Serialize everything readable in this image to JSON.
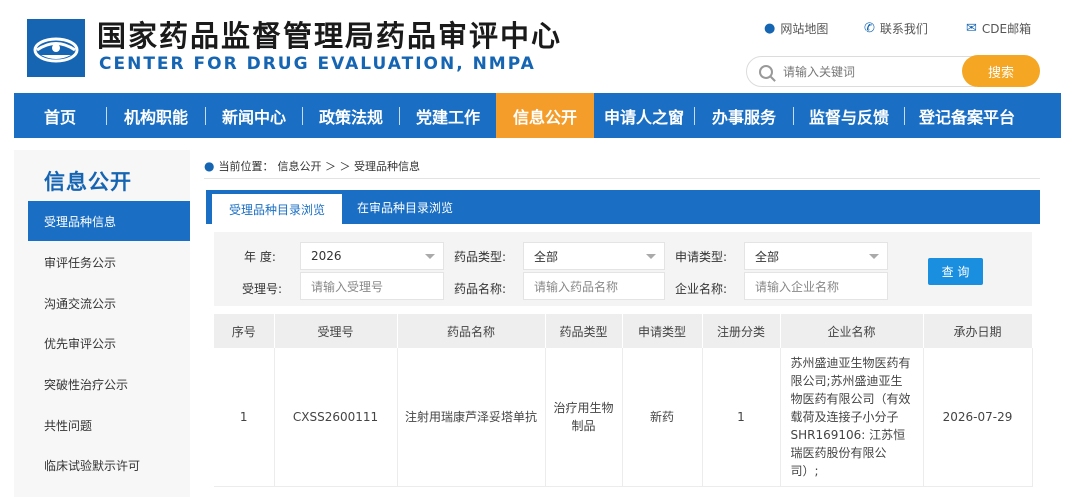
{
  "header": {
    "title_cn": "国家药品监督管理局药品审评中心",
    "title_en": "CENTER FOR DRUG EVALUATION, NMPA",
    "links": [
      {
        "label": "网站地图",
        "icon": "map-pin-icon"
      },
      {
        "label": "联系我们",
        "icon": "phone-icon"
      },
      {
        "label": "CDE邮箱",
        "icon": "mail-icon"
      }
    ],
    "search_placeholder": "请输入关键词",
    "search_button": "搜索",
    "brand_color": "#1565b3",
    "accent_color": "#f5a623"
  },
  "nav": {
    "items": [
      "首页",
      "机构职能",
      "新闻中心",
      "政策法规",
      "党建工作",
      "信息公开",
      "申请人之窗",
      "办事服务",
      "监督与反馈",
      "登记备案平台"
    ],
    "active": "信息公开"
  },
  "sidebar": {
    "title": "信息公开",
    "items": [
      "受理品种信息",
      "审评任务公示",
      "沟通交流公示",
      "优先审评公示",
      "突破性治疗公示",
      "共性问题",
      "临床试验默示许可"
    ],
    "active": "受理品种信息"
  },
  "breadcrumb": {
    "prefix": "当前位置：",
    "path": "信息公开 ＞ ＞ 受理品种信息"
  },
  "tabs": {
    "items": [
      "受理品种目录浏览",
      "在审品种目录浏览"
    ],
    "active": "受理品种目录浏览"
  },
  "filters": {
    "year_label": "年  度:",
    "year_value": "2026",
    "drug_type_label": "药品类型:",
    "drug_type_value": "全部",
    "apply_type_label": "申请类型:",
    "apply_type_value": "全部",
    "accept_no_label": "受理号:",
    "accept_no_placeholder": "请输入受理号",
    "drug_name_label": "药品名称:",
    "drug_name_placeholder": "请输入药品名称",
    "company_label": "企业名称:",
    "company_placeholder": "请输入企业名称",
    "query_button": "查 询"
  },
  "table": {
    "headers": [
      "序号",
      "受理号",
      "药品名称",
      "药品类型",
      "申请类型",
      "注册分类",
      "企业名称",
      "承办日期"
    ],
    "rows": [
      {
        "index": "1",
        "accept_no": "CXSS2600111",
        "drug_name": "注射用瑞康芦泽妥塔单抗",
        "drug_type": "治疗用生物制品",
        "apply_type": "新药",
        "reg_class": "1",
        "company": "苏州盛迪亚生物医药有限公司;苏州盛迪亚生物医药有限公司（有效载荷及连接子小分子SHR169106: 江苏恒瑞医药股份有限公司）;",
        "date": "2026-07-29"
      }
    ]
  }
}
